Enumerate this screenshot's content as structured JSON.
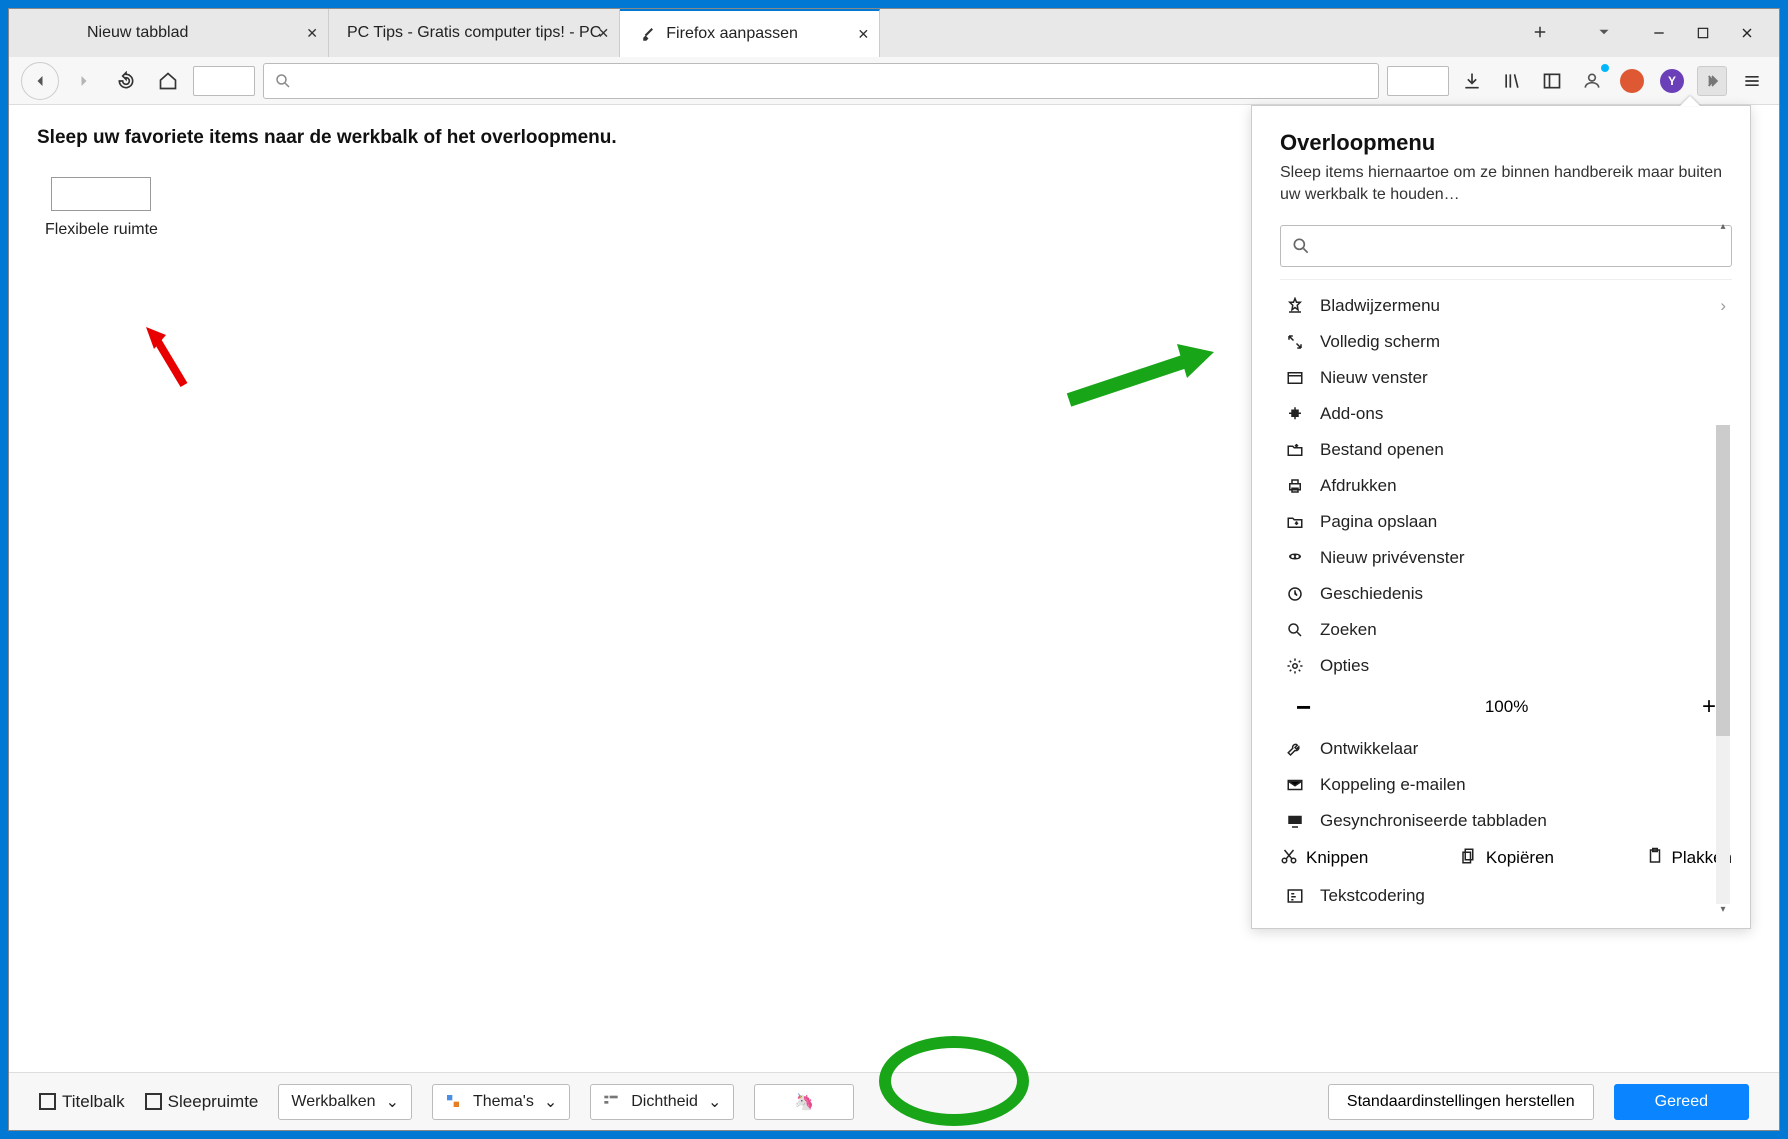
{
  "tabs": [
    {
      "label": "Nieuw tabblad"
    },
    {
      "label": "PC Tips - Gratis computer tips! - PC"
    },
    {
      "label": "Firefox aanpassen"
    }
  ],
  "customize": {
    "title": "Sleep uw favoriete items naar de werkbalk of het overloopmenu.",
    "flex_label": "Flexibele ruimte"
  },
  "overflow": {
    "title": "Overloopmenu",
    "desc": "Sleep items hiernaartoe om ze binnen handbereik maar buiten uw werkbalk te houden…",
    "items": {
      "bookmarks": "Bladwijzermenu",
      "fullscreen": "Volledig scherm",
      "newwindow": "Nieuw venster",
      "addons": "Add-ons",
      "openfile": "Bestand openen",
      "print": "Afdrukken",
      "savepage": "Pagina opslaan",
      "private": "Nieuw privévenster",
      "history": "Geschiedenis",
      "search": "Zoeken",
      "options": "Opties",
      "zoom": "100%",
      "developer": "Ontwikkelaar",
      "email": "Koppeling e-mailen",
      "synced": "Gesynchroniseerde tabbladen",
      "cut": "Knippen",
      "copy": "Kopiëren",
      "paste": "Plakken",
      "encoding": "Tekstcodering"
    }
  },
  "bottom": {
    "titlebar": "Titelbalk",
    "dragspace": "Sleepruimte",
    "toolbars": "Werkbalken",
    "themes": "Thema's",
    "density": "Dichtheid",
    "restore": "Standaardinstellingen herstellen",
    "done": "Gereed"
  }
}
